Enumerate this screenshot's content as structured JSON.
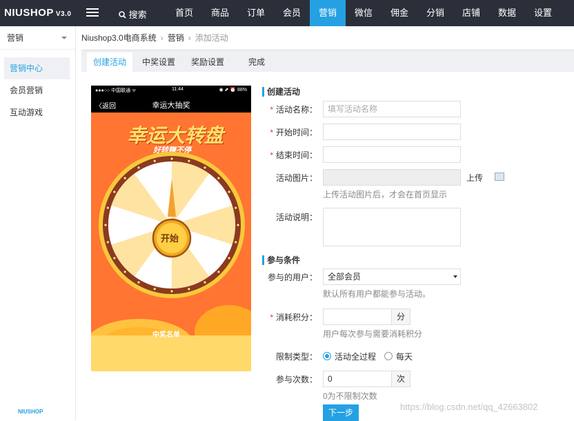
{
  "topbar": {
    "logo": "NIUSHOP",
    "version": "V3.0",
    "search_label": "搜索",
    "search_icon": "search-icon",
    "nav": [
      "首页",
      "商品",
      "订单",
      "会员",
      "营销",
      "微信",
      "佣金",
      "分销",
      "店铺",
      "数据",
      "设置"
    ],
    "active_nav": "营销",
    "accent": "#25a1e3"
  },
  "sidebar": {
    "header": "营销",
    "items": [
      "营销中心",
      "会员营销",
      "互动游戏"
    ],
    "active": "营销中心",
    "footer_logo": "NIUSHOP"
  },
  "breadcrumb": [
    "Niushop3.0电商系统",
    "营销",
    "添加活动"
  ],
  "tabs": [
    "创建活动",
    "中奖设置",
    "奖励设置",
    "完成"
  ],
  "preview": {
    "status_left": "●●●○○ 中国联通 ᯤ",
    "status_time": "11:44",
    "status_right": "◉ ⬈ ⏰ 88%",
    "back": "〈返回",
    "title": "幸运大抽奖",
    "banner_title": "幸运大转盘",
    "banner_sub": "好转赚不停",
    "start_button": "开始",
    "winners": "中奖名单"
  },
  "form": {
    "section1": "创建活动",
    "name_label": "活动名称：",
    "name_placeholder": "填写活动名称",
    "start_label": "开始时间：",
    "end_label": "结束时间：",
    "image_label": "活动图片：",
    "upload_label": "上传",
    "image_hint": "上传活动图片后，才会在首页显示",
    "desc_label": "活动说明：",
    "section2": "参与条件",
    "user_label": "参与的用户：",
    "user_value": "全部会员",
    "user_hint": "默认所有用户都能参与活动。",
    "points_label": "消耗积分：",
    "points_unit": "分",
    "points_hint": "用户每次参与需要消耗积分",
    "limit_label": "限制类型：",
    "limit_options": [
      "活动全过程",
      "每天"
    ],
    "limit_selected": "活动全过程",
    "times_label": "参与次数：",
    "times_value": "0",
    "times_unit": "次",
    "times_hint": "0为不限制次数",
    "next_button": "下一步"
  },
  "watermark": "https://blog.csdn.net/qq_42663802"
}
